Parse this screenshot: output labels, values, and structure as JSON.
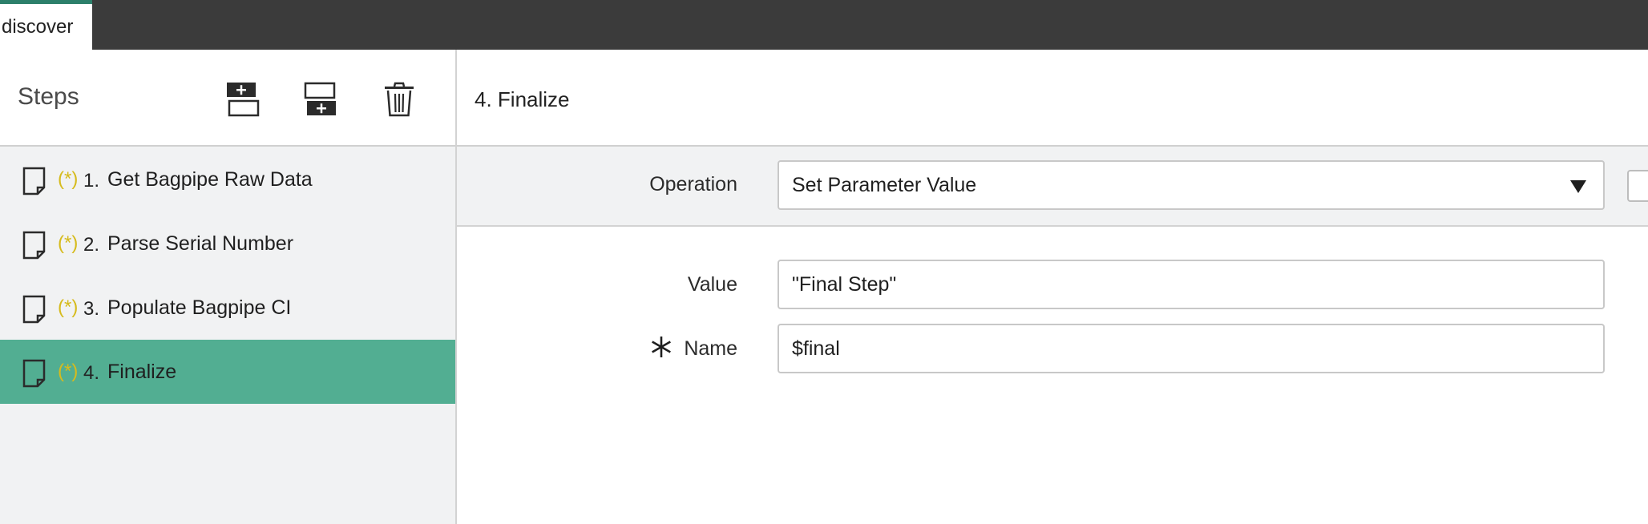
{
  "tabs": [
    {
      "label": "discover"
    }
  ],
  "steps_panel": {
    "title": "Steps",
    "tools": {
      "insert_above": "insert-step-above-icon",
      "insert_below": "insert-step-below-icon",
      "delete": "trash-icon"
    },
    "items": [
      {
        "marker": "(*)",
        "num": "1.",
        "label": "Get Bagpipe Raw Data",
        "selected": false
      },
      {
        "marker": "(*)",
        "num": "2.",
        "label": "Parse Serial Number",
        "selected": false
      },
      {
        "marker": "(*)",
        "num": "3.",
        "label": "Populate Bagpipe CI",
        "selected": false
      },
      {
        "marker": "(*)",
        "num": "4.",
        "label": "Finalize",
        "selected": true
      }
    ]
  },
  "detail": {
    "title": "4. Finalize",
    "operation": {
      "label": "Operation",
      "value": "Set Parameter Value"
    },
    "value_field": {
      "label": "Value",
      "value": "\"Final Step\""
    },
    "name_field": {
      "label": "Name",
      "value": "$final",
      "required": true
    }
  },
  "colors": {
    "topbar": "#3b3b3b",
    "tab_accent": "#2c7f6a",
    "selected_row": "#52ae92",
    "modified_marker": "#d6bb1d",
    "panel_bg": "#f1f2f3"
  }
}
